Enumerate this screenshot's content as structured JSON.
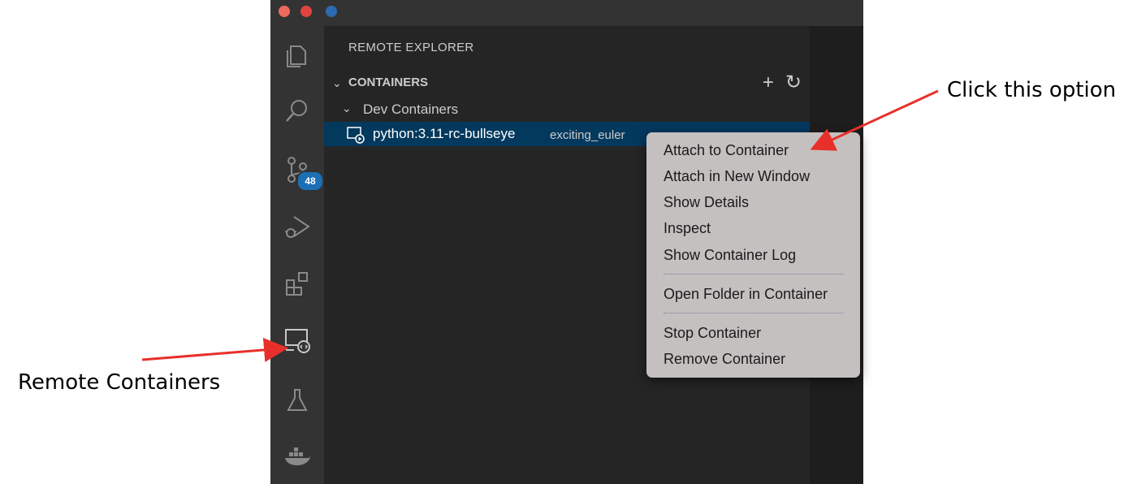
{
  "window": {
    "title_bar": {
      "buttons": [
        "close",
        "minimize",
        "zoom"
      ]
    },
    "activity_bar": {
      "items": [
        {
          "icon": "files-icon"
        },
        {
          "icon": "search-icon"
        },
        {
          "icon": "source-control-icon",
          "badge": "48"
        },
        {
          "icon": "run-debug-icon"
        },
        {
          "icon": "extensions-icon"
        },
        {
          "icon": "remote-explorer-icon"
        },
        {
          "icon": "testing-flask-icon"
        },
        {
          "icon": "docker-icon"
        }
      ]
    },
    "sidebar": {
      "title": "REMOTE EXPLORER",
      "section": {
        "label": "CONTAINERS",
        "actions": [
          "+",
          "↻"
        ]
      },
      "group": {
        "label": "Dev Containers"
      },
      "container": {
        "name": "python:3.11-rc-bullseye",
        "description": "exciting_euler"
      }
    }
  },
  "context_menu": {
    "items": [
      "Attach to Container",
      "Attach in New Window",
      "Show Details",
      "Inspect",
      "Show Container Log",
      "Open Folder in Container",
      "Stop Container",
      "Remove Container"
    ]
  },
  "annotations": {
    "right_note": "Click this option",
    "left_note": "Remote Containers",
    "arrow_color": "#e8302a"
  }
}
